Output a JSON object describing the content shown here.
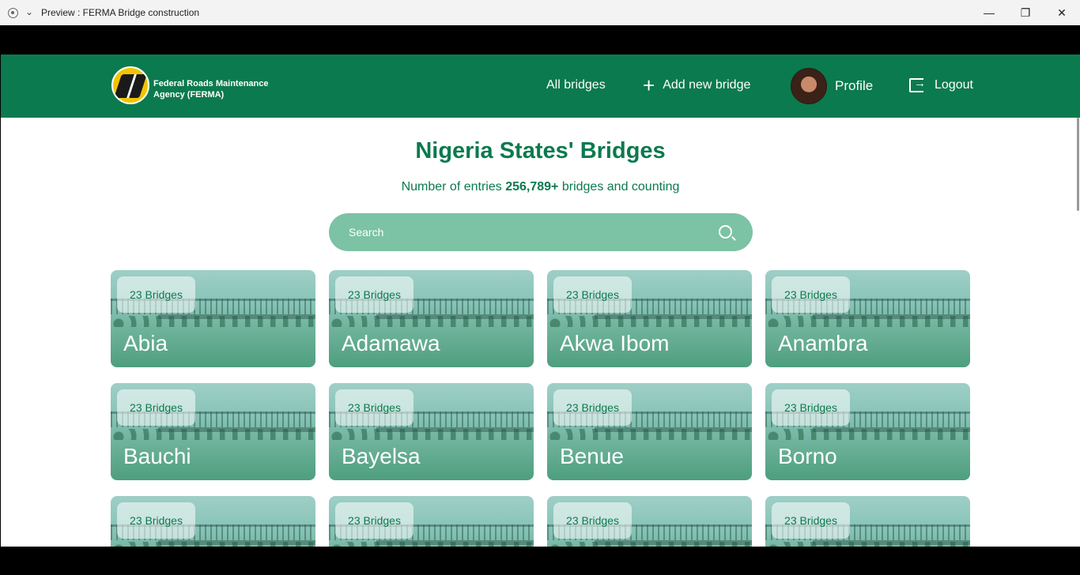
{
  "window": {
    "title": "Preview : FERMA Bridge construction",
    "chevron": "⌄",
    "minimize": "—",
    "maximize": "❐",
    "close": "✕"
  },
  "header": {
    "logo_text": "Federal Roads Maintenance Agency (FERMA)",
    "nav": {
      "all_bridges": "All bridges",
      "add_plus": "+",
      "add_new_bridge": "Add new bridge",
      "profile": "Profile",
      "logout": "Logout"
    }
  },
  "main": {
    "title": "Nigeria States' Bridges",
    "subtitle_prefix": "Number of entries",
    "subtitle_count": "256,789+",
    "subtitle_suffix": "bridges and counting",
    "search_placeholder": "Search"
  },
  "cards": [
    {
      "badge": "23 Bridges",
      "name": "Abia"
    },
    {
      "badge": "23 Bridges",
      "name": "Adamawa"
    },
    {
      "badge": "23 Bridges",
      "name": "Akwa Ibom"
    },
    {
      "badge": "23 Bridges",
      "name": "Anambra"
    },
    {
      "badge": "23 Bridges",
      "name": "Bauchi"
    },
    {
      "badge": "23 Bridges",
      "name": "Bayelsa"
    },
    {
      "badge": "23 Bridges",
      "name": "Benue"
    },
    {
      "badge": "23 Bridges",
      "name": "Borno"
    },
    {
      "badge": "23 Bridges",
      "name": ""
    },
    {
      "badge": "23 Bridges",
      "name": ""
    },
    {
      "badge": "23 Bridges",
      "name": ""
    },
    {
      "badge": "23 Bridges",
      "name": ""
    }
  ],
  "colors": {
    "brand_green": "#0b7a4e",
    "search_bg": "#7cc2a4"
  }
}
